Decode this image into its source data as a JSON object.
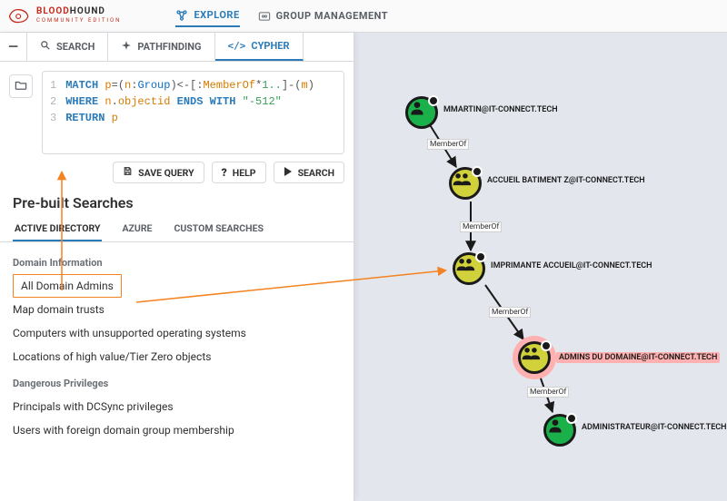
{
  "logo": {
    "primary": "BLOOD",
    "secondary": "HOUND",
    "tagline": "COMMUNITY EDITION"
  },
  "topnav": {
    "explore": "EXPLORE",
    "group_management": "GROUP MANAGEMENT"
  },
  "tabs": {
    "collapse": "—",
    "search": "SEARCH",
    "pathfinding": "PATHFINDING",
    "cypher": "CYPHER",
    "cypher_icon": "</>"
  },
  "query": {
    "lines": [
      {
        "n": "1"
      },
      {
        "n": "2"
      },
      {
        "n": "3"
      }
    ],
    "l1": {
      "kw1": "MATCH",
      "ident1": "p",
      "eq": "=(",
      "nodevar": "n",
      "colon": ":",
      "label": "Group",
      "rel1": ")<-[:",
      "rel": "MemberOf",
      "star": "*",
      "num": "1..",
      "rel2": "]-(",
      "m": "m",
      "close": ")"
    },
    "l2": {
      "kw": "WHERE",
      "var": "n",
      "dot": ".",
      "prop": "objectid",
      "op": "ENDS WITH",
      "str": "\"-512\""
    },
    "l3": {
      "kw": "RETURN",
      "var": "p"
    }
  },
  "buttons": {
    "save": "SAVE QUERY",
    "help": "HELP",
    "search": "SEARCH"
  },
  "prebuilt": {
    "title": "Pre-built Searches",
    "subtabs": {
      "ad": "ACTIVE DIRECTORY",
      "az": "AZURE",
      "custom": "CUSTOM SEARCHES"
    },
    "groups": [
      {
        "heading": "Domain Information",
        "items": [
          {
            "label": "All Domain Admins",
            "boxed": true
          },
          {
            "label": "Map domain trusts"
          },
          {
            "label": "Computers with unsupported operating systems"
          },
          {
            "label": "Locations of high value/Tier Zero objects"
          }
        ]
      },
      {
        "heading": "Dangerous Privileges",
        "items": [
          {
            "label": "Principals with DCSync privileges"
          },
          {
            "label": "Users with foreign domain group membership"
          }
        ]
      }
    ]
  },
  "graph": {
    "edge_label": "MemberOf",
    "nodes": [
      {
        "id": "mmartin",
        "kind": "user",
        "label": "MMARTIN@IT-CONNECT.TECH"
      },
      {
        "id": "accueilz",
        "kind": "group",
        "label": "ACCUEIL BATIMENT Z@IT-CONNECT.TECH"
      },
      {
        "id": "imp",
        "kind": "group",
        "label": "IMPRIMANTE ACCUEIL@IT-CONNECT.TECH"
      },
      {
        "id": "da",
        "kind": "group",
        "label": "ADMINS DU DOMAINE@IT-CONNECT.TECH",
        "highlight": true
      },
      {
        "id": "admin",
        "kind": "user",
        "label": "ADMINISTRATEUR@IT-CONNECT.TECH"
      }
    ]
  }
}
